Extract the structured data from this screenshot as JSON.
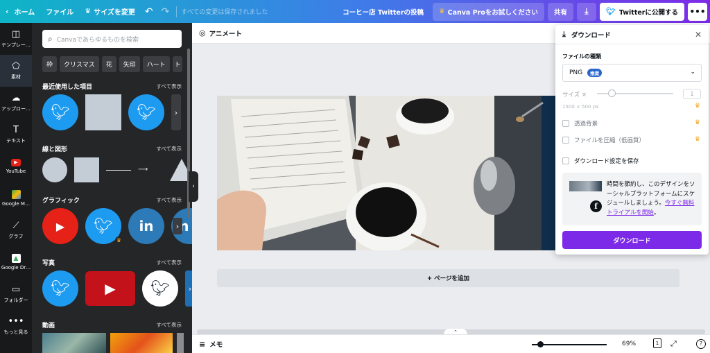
{
  "topbar": {
    "home": "ホーム",
    "file": "ファイル",
    "resize": "サイズを変更",
    "status": "すべての変更は保存されました",
    "design_title": "コーヒー店 Twitterの投稿",
    "canva_pro": "Canva Proをお試しください",
    "share": "共有",
    "publish": "Twitterに公開する"
  },
  "rail": {
    "items": [
      {
        "label": "テンプレー…",
        "icon": "template-icon"
      },
      {
        "label": "素材",
        "icon": "elements-icon"
      },
      {
        "label": "アップロー…",
        "icon": "upload-icon"
      },
      {
        "label": "テキスト",
        "icon": "text-icon"
      },
      {
        "label": "YouTube",
        "icon": "youtube-icon"
      },
      {
        "label": "Google M…",
        "icon": "google-maps-icon"
      },
      {
        "label": "グラフ",
        "icon": "chart-icon"
      },
      {
        "label": "Google Dr…",
        "icon": "google-drive-icon"
      },
      {
        "label": "フォルダー",
        "icon": "folder-icon"
      },
      {
        "label": "もっと見る",
        "icon": "more-icon"
      }
    ]
  },
  "panel": {
    "search_placeholder": "Canvaであらゆるものを検索",
    "chips": [
      "枠",
      "クリスマス",
      "花",
      "矢印",
      "ハート",
      "ト"
    ],
    "see_all": "すべて表示",
    "sections": {
      "recent": "最近使用した項目",
      "lines": "線と図形",
      "graphics": "グラフィック",
      "photos": "写真",
      "videos": "動画"
    }
  },
  "canvas": {
    "animate": "アニメート",
    "add_page": "+ ページを追加",
    "memo": "メモ",
    "zoom": "69%",
    "page_count": "1"
  },
  "download": {
    "title": "ダウンロード",
    "file_type_label": "ファイルの種類",
    "file_type": "PNG",
    "recommended": "推奨",
    "size_label": "サイズ ×",
    "size_value": "1",
    "dims": "1500 × 500 px",
    "transparent": "透過背景",
    "compress": "ファイルを圧縮（低画質）",
    "save_settings": "ダウンロード設定を保存",
    "promo_text": "時間を節約し、このデザインをソーシャルプラットフォームにスケジュールしましょう。",
    "promo_link": "今すぐ無料トライアルを開始",
    "promo_end": "。",
    "button": "ダウンロード"
  },
  "colors": {
    "accent": "#7d2ae8",
    "twitter": "#1d9bf0",
    "youtube": "#e62117",
    "linkedin": "#2d7ab8"
  }
}
